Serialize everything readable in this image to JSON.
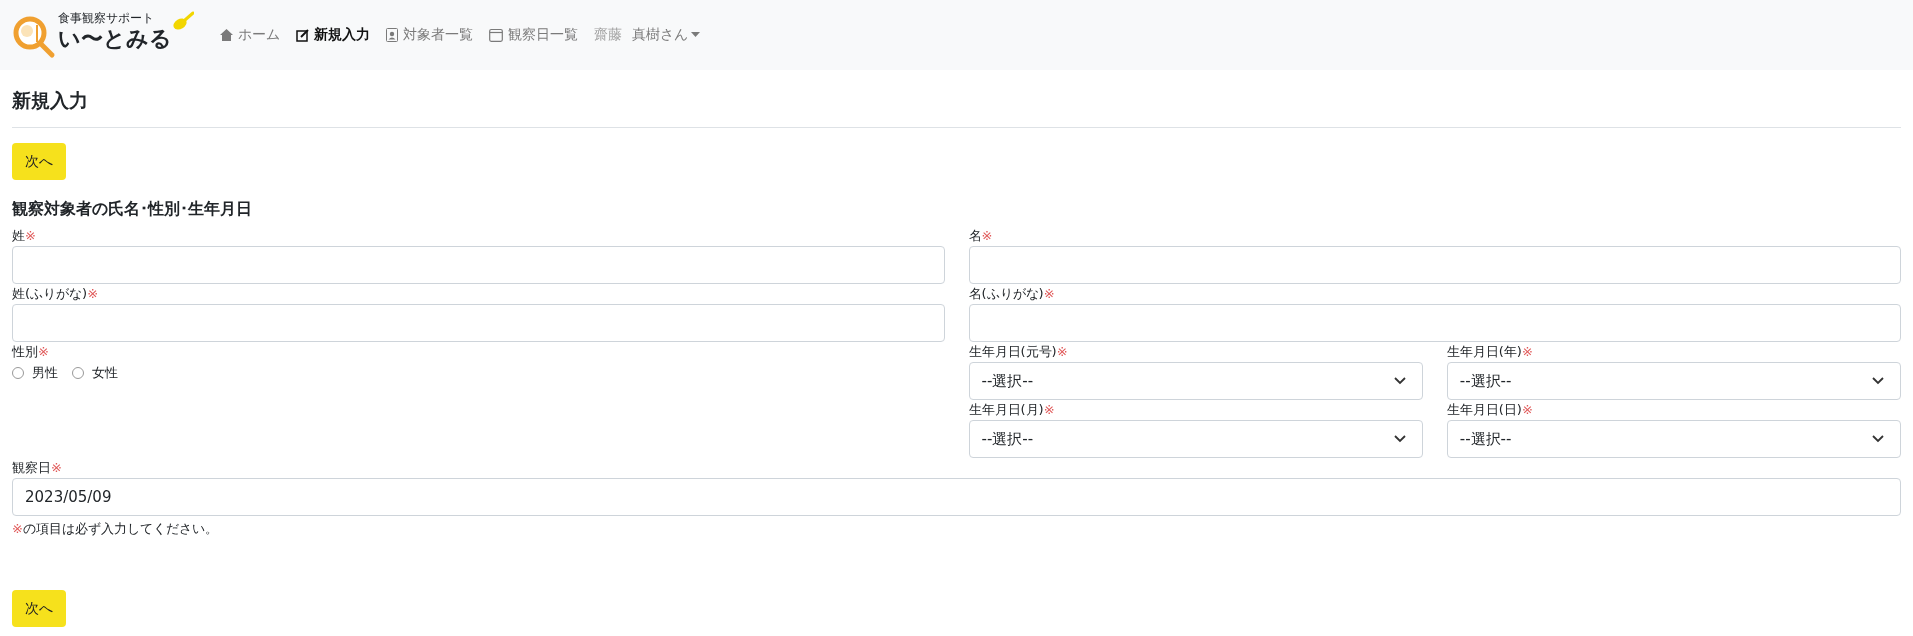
{
  "brand": {
    "tagline": "食事観察サポート",
    "name": "い〜とみる"
  },
  "nav": [
    {
      "kind": "home",
      "label": "ホーム",
      "selected": false
    },
    {
      "kind": "edit",
      "label": "新規入力",
      "selected": true
    },
    {
      "kind": "contact",
      "label": "対象者一覧",
      "selected": false
    },
    {
      "kind": "calendar",
      "label": "観察日一覧",
      "selected": false
    }
  ],
  "user": {
    "surname": "齋藤",
    "name": "真樹さん"
  },
  "page_title": "新規入力",
  "next_button": "次へ",
  "section_title": "観察対象者の氏名･性別･生年月日",
  "name_fields": [
    {
      "label": "姓",
      "mark": "※"
    },
    {
      "label": "名",
      "mark": "※"
    },
    {
      "label": "姓(ふりがな)",
      "mark": "※"
    },
    {
      "label": "名(ふりがな)",
      "mark": "※"
    }
  ],
  "gender": {
    "label": "性別",
    "mark": "※",
    "options": [
      {
        "label": "男性",
        "selected": false
      },
      {
        "label": "女性",
        "selected": false
      }
    ]
  },
  "birth_selects": [
    {
      "label": "生年月日(元号)",
      "mark": "※",
      "value": "--選択--"
    },
    {
      "label": "生年月日(年)",
      "mark": "※",
      "value": "--選択--"
    },
    {
      "label": "生年月日(月)",
      "mark": "※",
      "value": "--選択--"
    },
    {
      "label": "生年月日(日)",
      "mark": "※",
      "value": "--選択--"
    }
  ],
  "observation_date": {
    "label": "観察日",
    "mark": "※",
    "value": "2023/05/09"
  },
  "note": {
    "mark": "※",
    "text": "の項目は必ず入力してください。"
  },
  "bottom_button": "次へ"
}
